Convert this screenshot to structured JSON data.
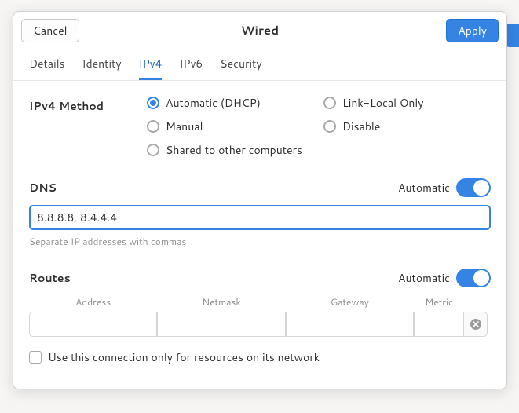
{
  "header": {
    "cancel": "Cancel",
    "title": "Wired",
    "apply": "Apply"
  },
  "tabs": [
    "Details",
    "Identity",
    "IPv4",
    "IPv6",
    "Security"
  ],
  "active_tab": "IPv4",
  "method": {
    "label": "IPv4 Method",
    "options": {
      "auto": "Automatic (DHCP)",
      "link_local": "Link-Local Only",
      "manual": "Manual",
      "disable": "Disable",
      "shared": "Shared to other computers"
    },
    "selected": "auto"
  },
  "dns": {
    "title": "DNS",
    "automatic_label": "Automatic",
    "automatic_on": true,
    "value": "8.8.8.8, 8.4.4.4",
    "hint": "Separate IP addresses with commas"
  },
  "routes": {
    "title": "Routes",
    "automatic_label": "Automatic",
    "automatic_on": true,
    "columns": {
      "address": "Address",
      "netmask": "Netmask",
      "gateway": "Gateway",
      "metric": "Metric"
    },
    "row": {
      "address": "",
      "netmask": "",
      "gateway": "",
      "metric": ""
    },
    "only_resources_label": "Use this connection only for resources on its network",
    "only_resources_checked": false
  }
}
